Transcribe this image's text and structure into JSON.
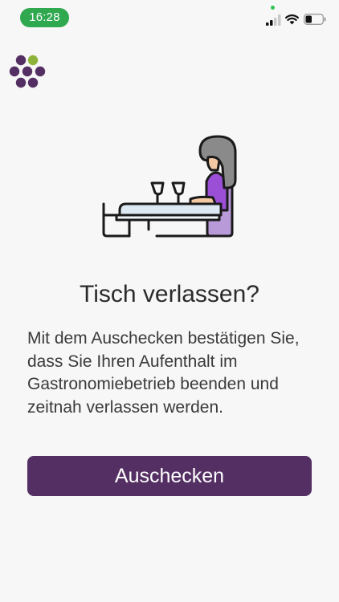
{
  "status_bar": {
    "time": "16:28",
    "time_pill_color": "#2fa84f",
    "icons": [
      "signal-icon",
      "wifi-icon",
      "battery-icon"
    ]
  },
  "brand": {
    "logo_icon": "grape-logo",
    "primary_color": "#542f63",
    "accent_color": "#8db33a"
  },
  "main": {
    "illustration": "person-at-bar-icon",
    "title": "Tisch verlassen?",
    "description": "Mit dem Auschecken bestätigen Sie, dass Sie Ihren Aufenthalt im Gastronomiebetrieb beenden und zeitnah verlassen werden.",
    "checkout_label": "Auschecken"
  }
}
